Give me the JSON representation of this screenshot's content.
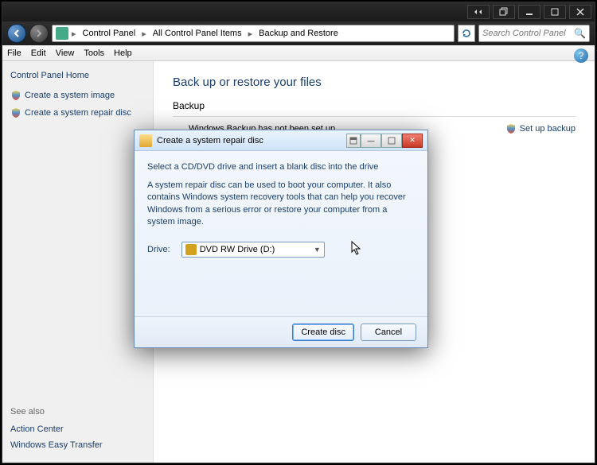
{
  "titlebar": {},
  "breadcrumb": {
    "root": "Control Panel",
    "mid": "All Control Panel Items",
    "leaf": "Backup and Restore"
  },
  "search": {
    "placeholder": "Search Control Panel"
  },
  "menu": {
    "file": "File",
    "edit": "Edit",
    "view": "View",
    "tools": "Tools",
    "help": "Help"
  },
  "sidebar": {
    "home": "Control Panel Home",
    "link1": "Create a system image",
    "link2": "Create a system repair disc",
    "seealso": "See also",
    "s1": "Action Center",
    "s2": "Windows Easy Transfer"
  },
  "main": {
    "title": "Back up or restore your files",
    "section": "Backup",
    "msg": "Windows Backup has not been set up.",
    "action": "Set up backup"
  },
  "dialog": {
    "title": "Create a system repair disc",
    "line1": "Select a CD/DVD drive and insert a blank disc into the drive",
    "line2": "A system repair disc can be used to boot your computer. It also contains Windows system recovery tools that can help you recover Windows from a serious error or restore your computer from a system image.",
    "drive_label": "Drive:",
    "drive_value": "DVD RW Drive (D:)",
    "create": "Create disc",
    "cancel": "Cancel"
  }
}
